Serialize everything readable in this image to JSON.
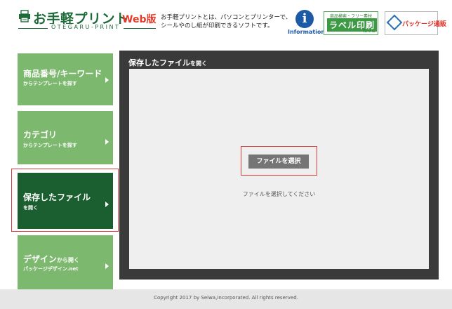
{
  "header": {
    "logo_main": "お手軽プリント",
    "logo_web": "Web版",
    "logo_sub": "OTEGARU-PRINT",
    "tagline_line1": "お手軽プリントとは、パソコンとプリンターで、",
    "tagline_line2": "シールやのし紙が印刷できるソフトです。",
    "info_glyph": "i",
    "info_label": "Information",
    "banner_label_small": "商品検索・フリー素材",
    "banner_label_big": "ラベル印刷",
    "banner_label_tail": "ねっと",
    "banner_pkg_text": "パッケージ通販"
  },
  "sidebar": {
    "items": [
      {
        "title": "商品番号/キーワード",
        "title_suffix": "",
        "sub": "からテンプレートを探す"
      },
      {
        "title": "カテゴリ",
        "title_suffix": "",
        "sub": "からテンプレートを探す"
      },
      {
        "title": "保存したファイル",
        "title_suffix": "",
        "sub": "を開く"
      },
      {
        "title": "デザイン",
        "title_suffix": "から開く",
        "sub": "パッケージデザイン.net"
      }
    ],
    "active_index": 2
  },
  "main": {
    "title": "保存したファイル",
    "title_suffix": "を開く",
    "choose_button": "ファイルを選択",
    "hint": "ファイルを選択してください"
  },
  "footer": {
    "copyright": "Copyright 2017 by Seiwa,Incorporated. All rights reserved."
  },
  "colors": {
    "brand_green": "#1e6b3a",
    "sidebar_green": "#7cb86d",
    "sidebar_active": "#1b5e2f",
    "panel_dark": "#3a3a3a",
    "highlight_red": "#d93c3c",
    "web_red": "#e23a2a",
    "info_blue": "#1d5aa6"
  }
}
